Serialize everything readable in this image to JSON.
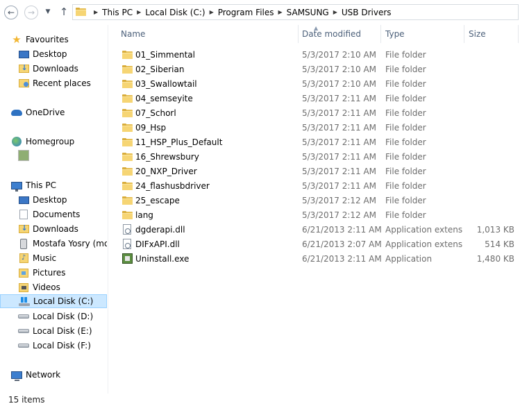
{
  "address_bar": {
    "crumbs": [
      "This PC",
      "Local Disk (C:)",
      "Program Files",
      "SAMSUNG",
      "USB Drivers"
    ]
  },
  "nav_pane": {
    "favourites": {
      "label": "Favourites",
      "items": [
        "Desktop",
        "Downloads",
        "Recent places"
      ]
    },
    "onedrive": {
      "label": "OneDrive"
    },
    "homegroup": {
      "label": "Homegroup"
    },
    "this_pc": {
      "label": "This PC",
      "items": [
        "Desktop",
        "Documents",
        "Downloads",
        "Mostafa Yosry (mos",
        "Music",
        "Pictures",
        "Videos",
        "Local Disk (C:)",
        "Local Disk (D:)",
        "Local Disk (E:)",
        "Local Disk (F:)"
      ]
    },
    "network": {
      "label": "Network"
    }
  },
  "columns": {
    "name": "Name",
    "date": "Date modified",
    "type": "Type",
    "size": "Size"
  },
  "files": [
    {
      "name": "01_Simmental",
      "date": "5/3/2017 2:10 AM",
      "type": "File folder",
      "size": "",
      "icon": "folder-icon"
    },
    {
      "name": "02_Siberian",
      "date": "5/3/2017 2:10 AM",
      "type": "File folder",
      "size": "",
      "icon": "folder-icon"
    },
    {
      "name": "03_Swallowtail",
      "date": "5/3/2017 2:10 AM",
      "type": "File folder",
      "size": "",
      "icon": "folder-icon"
    },
    {
      "name": "04_semseyite",
      "date": "5/3/2017 2:11 AM",
      "type": "File folder",
      "size": "",
      "icon": "folder-icon"
    },
    {
      "name": "07_Schorl",
      "date": "5/3/2017 2:11 AM",
      "type": "File folder",
      "size": "",
      "icon": "folder-icon"
    },
    {
      "name": "09_Hsp",
      "date": "5/3/2017 2:11 AM",
      "type": "File folder",
      "size": "",
      "icon": "folder-icon"
    },
    {
      "name": "11_HSP_Plus_Default",
      "date": "5/3/2017 2:11 AM",
      "type": "File folder",
      "size": "",
      "icon": "folder-icon"
    },
    {
      "name": "16_Shrewsbury",
      "date": "5/3/2017 2:11 AM",
      "type": "File folder",
      "size": "",
      "icon": "folder-icon"
    },
    {
      "name": "20_NXP_Driver",
      "date": "5/3/2017 2:11 AM",
      "type": "File folder",
      "size": "",
      "icon": "folder-icon"
    },
    {
      "name": "24_flashusbdriver",
      "date": "5/3/2017 2:11 AM",
      "type": "File folder",
      "size": "",
      "icon": "folder-icon"
    },
    {
      "name": "25_escape",
      "date": "5/3/2017 2:12 AM",
      "type": "File folder",
      "size": "",
      "icon": "folder-icon"
    },
    {
      "name": "lang",
      "date": "5/3/2017 2:12 AM",
      "type": "File folder",
      "size": "",
      "icon": "folder-icon"
    },
    {
      "name": "dgderapi.dll",
      "date": "6/21/2013 2:11 AM",
      "type": "Application extens...",
      "size": "1,013 KB",
      "icon": "dll-icon"
    },
    {
      "name": "DIFxAPI.dll",
      "date": "6/21/2013 2:07 AM",
      "type": "Application extens...",
      "size": "514 KB",
      "icon": "dll-icon"
    },
    {
      "name": "Uninstall.exe",
      "date": "6/21/2013 2:11 AM",
      "type": "Application",
      "size": "1,480 KB",
      "icon": "exe-icon"
    }
  ],
  "status_bar": {
    "item_count": "15 items"
  }
}
